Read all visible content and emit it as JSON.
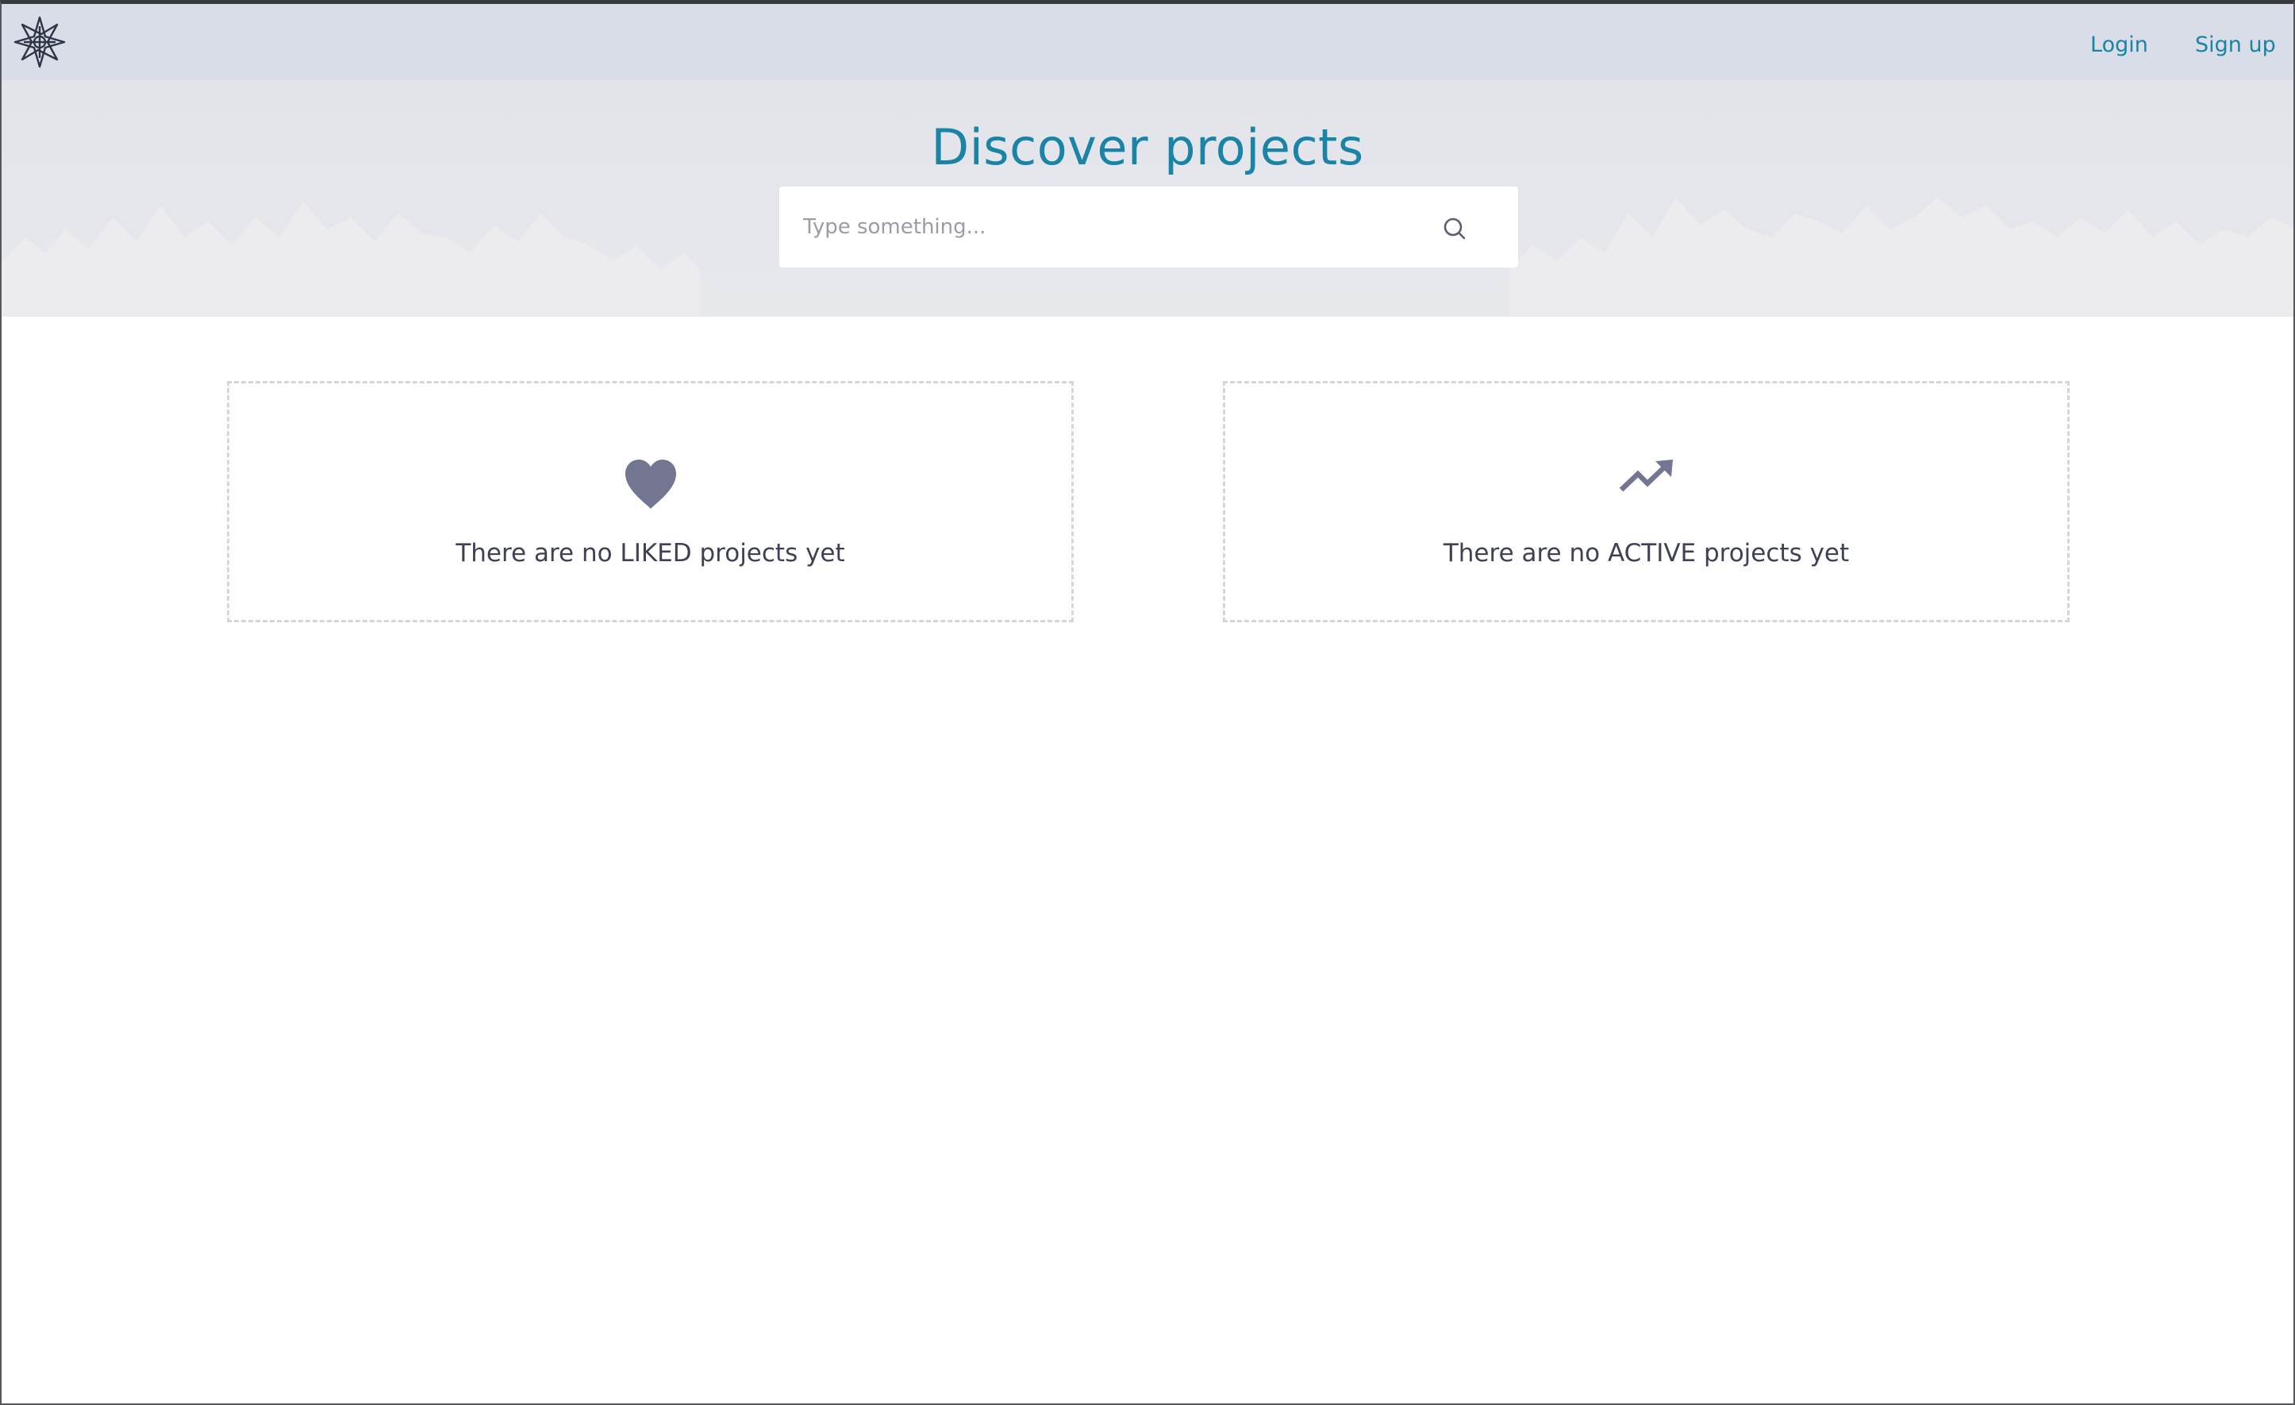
{
  "nav": {
    "logo_icon": "snowflake-logo-icon",
    "login_label": "Login",
    "signup_label": "Sign up"
  },
  "hero": {
    "title": "Discover projects",
    "search_placeholder": "Type something...",
    "search_value": "",
    "search_icon": "search-icon"
  },
  "cards": [
    {
      "icon": "heart-icon",
      "message": "There are no LIKED projects yet"
    },
    {
      "icon": "trending-up-icon",
      "message": "There are no ACTIVE projects yet"
    }
  ],
  "colors": {
    "accent": "#1a84a6",
    "nav_background": "#d8dde8",
    "hero_background": "#e4e6eb",
    "icon_color": "#737591",
    "text_color": "#3f4255",
    "dashed_border": "#d5d6da"
  }
}
